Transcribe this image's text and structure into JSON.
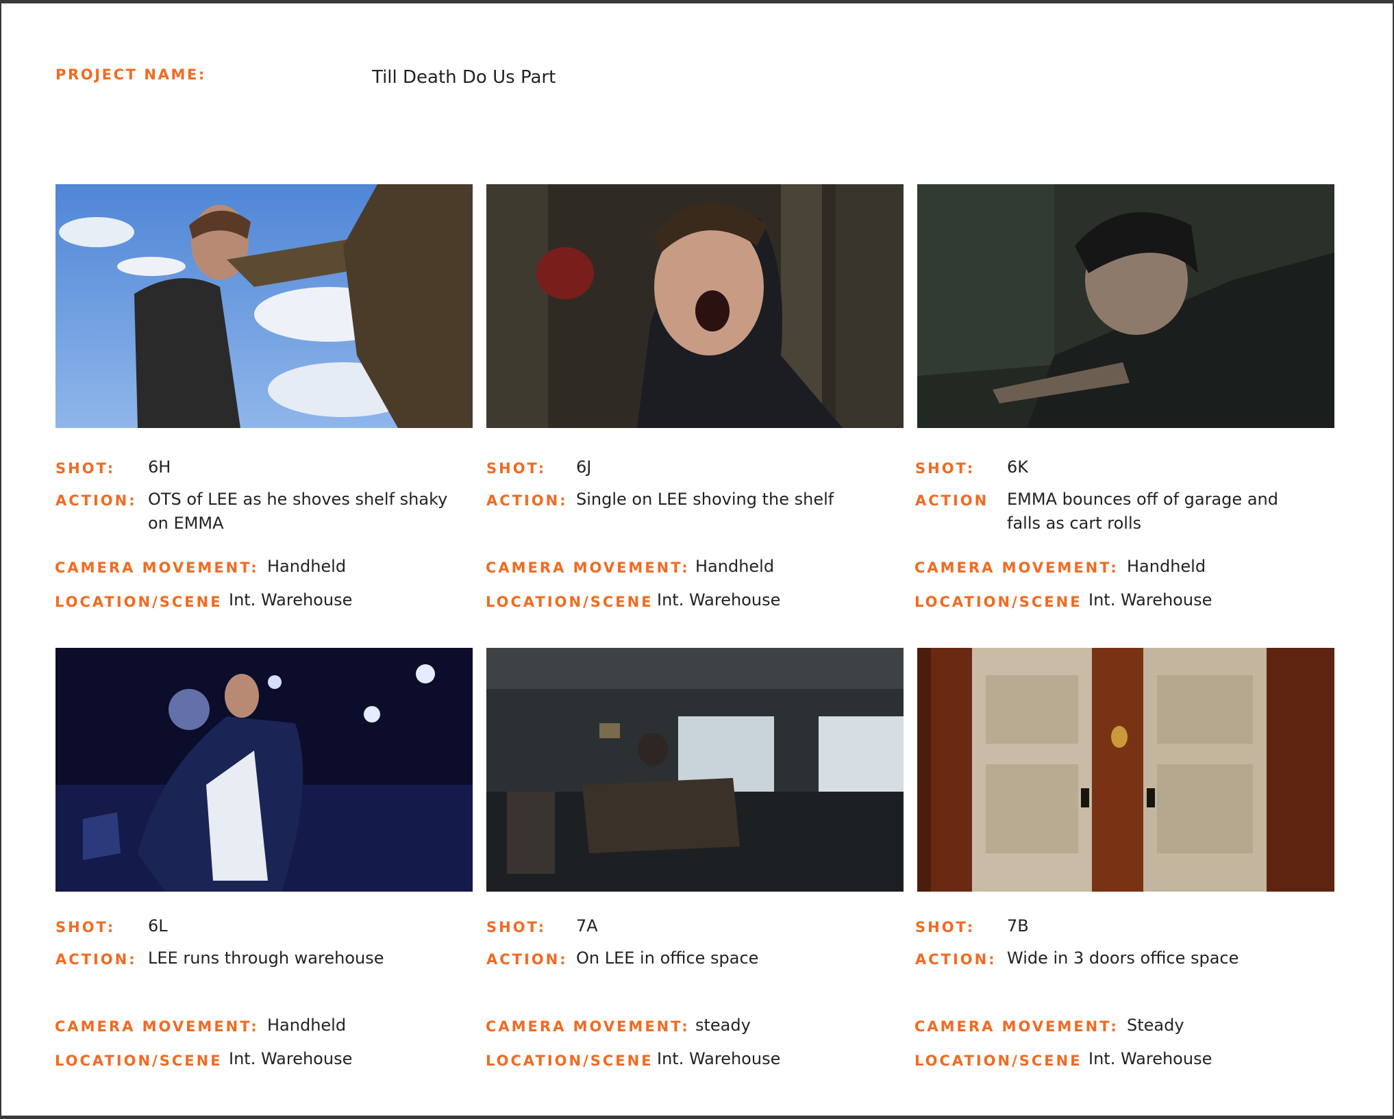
{
  "project": {
    "label": "PROJECT NAME:",
    "value": "Till Death Do Us Part"
  },
  "shots": [
    {
      "shot_label": "SHOT:",
      "shot": "6H",
      "action_label": "ACTION:",
      "action": "OTS of LEE as he shoves shelf shaky on EMMA",
      "camera_label": "CAMERA MOVEMENT:",
      "camera": "Handheld",
      "location_label": "LOCATION/SCENE",
      "location": "Int. Warehouse"
    },
    {
      "shot_label": "SHOT:",
      "shot": "6J",
      "action_label": "ACTION:",
      "action": "Single on LEE shoving the shelf",
      "camera_label": "CAMERA MOVEMENT:",
      "camera": "Handheld",
      "location_label": "LOCATION/SCENE",
      "location": "Int. Warehouse"
    },
    {
      "shot_label": "SHOT:",
      "shot": "6K",
      "action_label": "ACTION",
      "action": "EMMA bounces off of garage and falls as cart rolls",
      "camera_label": "CAMERA MOVEMENT:",
      "camera": "Handheld",
      "location_label": "LOCATION/SCENE",
      "location": "Int. Warehouse"
    },
    {
      "shot_label": "SHOT:",
      "shot": "6L",
      "action_label": "ACTION:",
      "action": "LEE runs through warehouse",
      "camera_label": "CAMERA MOVEMENT:",
      "camera": "Handheld",
      "location_label": "LOCATION/SCENE",
      "location": "Int. Warehouse"
    },
    {
      "shot_label": "SHOT:",
      "shot": "7A",
      "action_label": "ACTION:",
      "action": "On LEE in office space",
      "camera_label": "CAMERA MOVEMENT:",
      "camera": "steady",
      "location_label": "LOCATION/SCENE",
      "location": "Int. Warehouse"
    },
    {
      "shot_label": "SHOT:",
      "shot": "7B",
      "action_label": "ACTION:",
      "action": "Wide in 3 doors office space",
      "camera_label": "CAMERA MOVEMENT:",
      "camera": "Steady",
      "location_label": "LOCATION/SCENE",
      "location": "Int. Warehouse"
    }
  ]
}
